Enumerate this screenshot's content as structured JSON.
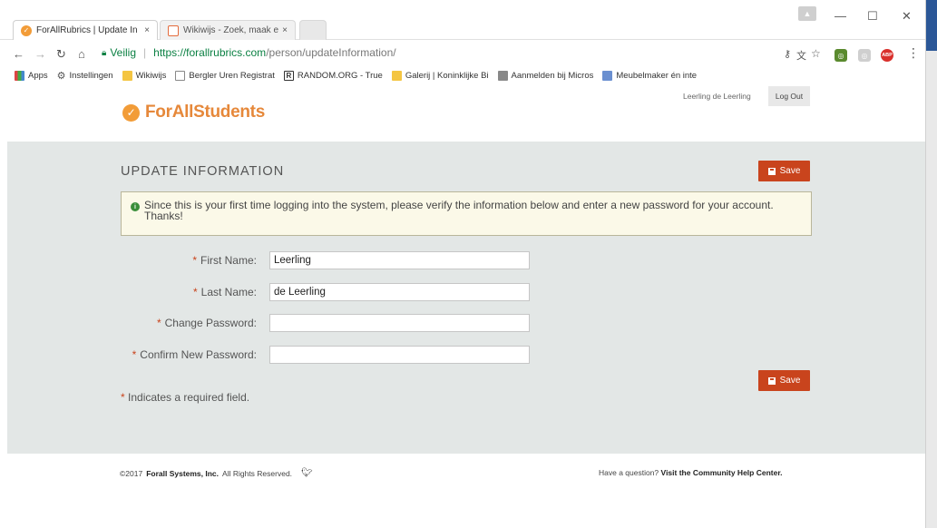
{
  "browser": {
    "tabs": [
      {
        "title": "ForAllRubrics | Update In",
        "active": true
      },
      {
        "title": "Wikiwijs - Zoek, maak en",
        "active": false
      }
    ],
    "close_glyph": "×",
    "address": {
      "secure_label": "Veilig",
      "host": "https://forallrubrics.com",
      "path": "/person/updateInformation/"
    },
    "bookmarks": [
      {
        "label": "Apps",
        "icon": "apps-grid-icon",
        "color": "#d44"
      },
      {
        "label": "Instellingen",
        "icon": "gear-icon",
        "color": "#555"
      },
      {
        "label": "Wikiwijs",
        "icon": "folder-icon",
        "color": "#f4c542"
      },
      {
        "label": "Bergler Uren Registrat",
        "icon": "doc-icon",
        "color": "#888"
      },
      {
        "label": "RANDOM.ORG - True",
        "icon": "random-icon",
        "color": "#333"
      },
      {
        "label": "Galerij | Koninklijke Bi",
        "icon": "kb-icon",
        "color": "#f4c542"
      },
      {
        "label": "Aanmelden bij Micros",
        "icon": "microsoft-icon",
        "color": "#666"
      },
      {
        "label": "Meubelmaker én inte",
        "icon": "meubel-icon",
        "color": "#6a8fd0"
      }
    ],
    "extensions": [
      {
        "name": "shield-extension-icon",
        "color": "#5a8a2e",
        "glyph": "◎"
      },
      {
        "name": "grey-extension-icon",
        "color": "#cfcfcf",
        "glyph": "◎"
      },
      {
        "name": "adblock-icon",
        "color": "#d9302c",
        "glyph": "ABP"
      }
    ],
    "window_controls": {
      "minimize": "—",
      "maximize": "☐",
      "close": "✕"
    }
  },
  "header": {
    "logo_for": "ForAll",
    "logo_students": "Students",
    "user_name": "Leerling de Leerling",
    "logout_label": "Log Out"
  },
  "main": {
    "title": "UPDATE INFORMATION",
    "save_label": "Save",
    "notice": "Since this is your first time logging into the system, please verify the information below and enter a new password for your account. Thanks!",
    "fields": [
      {
        "label": "First Name:",
        "value": "Leerling",
        "type": "text"
      },
      {
        "label": "Last Name:",
        "value": "de Leerling",
        "type": "text"
      },
      {
        "label": "Change Password:",
        "value": "",
        "type": "password"
      },
      {
        "label": "Confirm New Password:",
        "value": "",
        "type": "password"
      }
    ],
    "required_marker": "*",
    "required_note": "Indicates a required field."
  },
  "footer": {
    "copyright_prefix": "©2017",
    "company": "Forall Systems, Inc.",
    "rights": "All Rights Reserved.",
    "help_question": "Have a question?",
    "help_link": "Visit the Community Help Center."
  },
  "colors": {
    "accent": "#c9441d",
    "brand_orange": "#f29c38",
    "band_bg": "#e3e7e6",
    "secure_green": "#0b8043"
  }
}
